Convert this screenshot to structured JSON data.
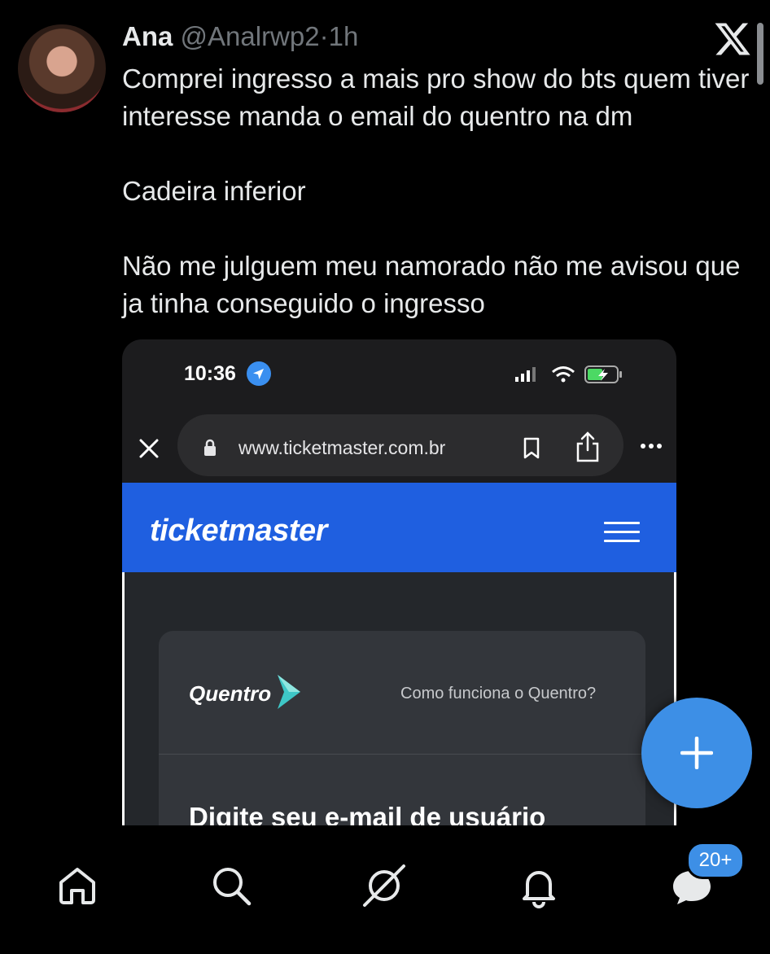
{
  "tweet": {
    "author_name": "Ana",
    "handle": "@Analrwp2",
    "separator": "·",
    "time": "1h",
    "text_line1": "Comprei ingresso a mais pro show do bts quem tiver interesse manda o email do quentro na dm",
    "text_line2": "Cadeira inferior",
    "text_line3": "Não me julguem meu namorado não me avisou que ja tinha conseguido o ingresso"
  },
  "media": {
    "status_time": "10:36",
    "url": "www.ticketmaster.com.br",
    "site_logo": "ticketmaster",
    "quentro_logo": "Quentro",
    "quentro_help": "Como funciona o Quentro?",
    "form_heading": "Digite seu e-mail de usuário"
  },
  "fab": {
    "icon": "plus-icon"
  },
  "nav": {
    "items": [
      "home-icon",
      "search-icon",
      "grok-icon",
      "notifications-icon",
      "messages-icon"
    ],
    "messages_badge": "20+"
  },
  "colors": {
    "background": "#000000",
    "accent": "#3d8fe6",
    "ticketmaster_blue": "#1f5fe0",
    "muted_text": "#71767b"
  }
}
